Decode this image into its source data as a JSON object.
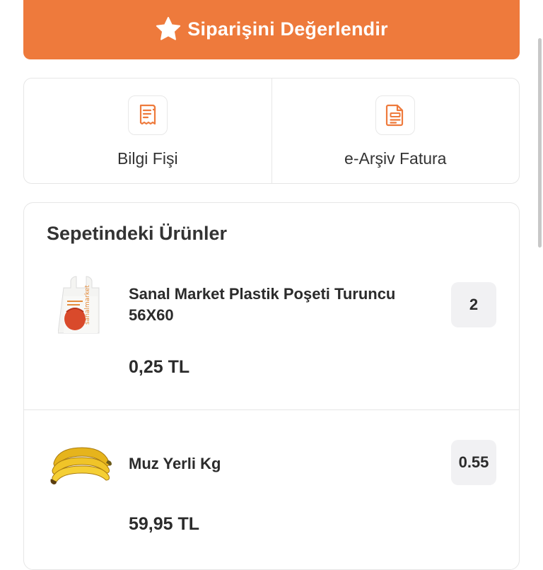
{
  "rate_button": {
    "label": "Siparişini Değerlendir",
    "icon": "star-icon"
  },
  "documents": [
    {
      "label": "Bilgi Fişi",
      "icon": "receipt-icon"
    },
    {
      "label": "e-Arşiv Fatura",
      "icon": "document-icon"
    }
  ],
  "basket": {
    "title": "Sepetindeki Ürünler",
    "products": [
      {
        "name": "Sanal Market Plastik Poşeti Turuncu 56X60",
        "price": "0,25 TL",
        "quantity": "2",
        "image": "plastic-bag-image"
      },
      {
        "name": "Muz Yerli Kg",
        "price": "59,95 TL",
        "quantity": "0.55",
        "image": "banana-image"
      }
    ]
  },
  "colors": {
    "accent": "#ee7a3c",
    "border": "#e6e6e6",
    "qty_bg": "#f1f1f3",
    "text": "#2b2b2b"
  }
}
